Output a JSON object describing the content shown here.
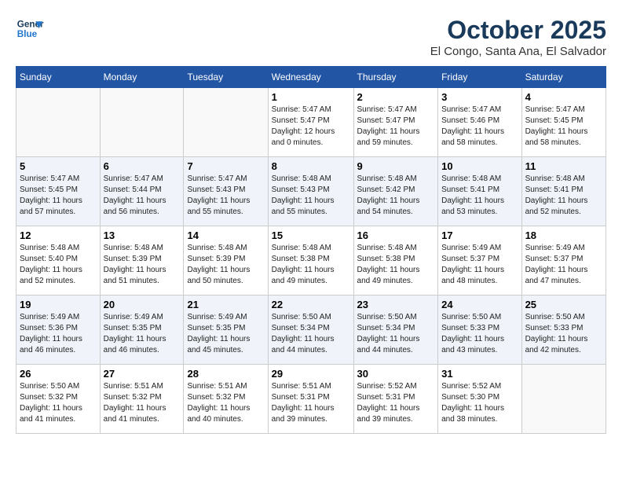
{
  "header": {
    "logo_line1": "General",
    "logo_line2": "Blue",
    "title": "October 2025",
    "subtitle": "El Congo, Santa Ana, El Salvador"
  },
  "weekdays": [
    "Sunday",
    "Monday",
    "Tuesday",
    "Wednesday",
    "Thursday",
    "Friday",
    "Saturday"
  ],
  "weeks": [
    [
      {
        "day": "",
        "info": ""
      },
      {
        "day": "",
        "info": ""
      },
      {
        "day": "",
        "info": ""
      },
      {
        "day": "1",
        "info": "Sunrise: 5:47 AM\nSunset: 5:47 PM\nDaylight: 12 hours\nand 0 minutes."
      },
      {
        "day": "2",
        "info": "Sunrise: 5:47 AM\nSunset: 5:47 PM\nDaylight: 11 hours\nand 59 minutes."
      },
      {
        "day": "3",
        "info": "Sunrise: 5:47 AM\nSunset: 5:46 PM\nDaylight: 11 hours\nand 58 minutes."
      },
      {
        "day": "4",
        "info": "Sunrise: 5:47 AM\nSunset: 5:45 PM\nDaylight: 11 hours\nand 58 minutes."
      }
    ],
    [
      {
        "day": "5",
        "info": "Sunrise: 5:47 AM\nSunset: 5:45 PM\nDaylight: 11 hours\nand 57 minutes."
      },
      {
        "day": "6",
        "info": "Sunrise: 5:47 AM\nSunset: 5:44 PM\nDaylight: 11 hours\nand 56 minutes."
      },
      {
        "day": "7",
        "info": "Sunrise: 5:47 AM\nSunset: 5:43 PM\nDaylight: 11 hours\nand 55 minutes."
      },
      {
        "day": "8",
        "info": "Sunrise: 5:48 AM\nSunset: 5:43 PM\nDaylight: 11 hours\nand 55 minutes."
      },
      {
        "day": "9",
        "info": "Sunrise: 5:48 AM\nSunset: 5:42 PM\nDaylight: 11 hours\nand 54 minutes."
      },
      {
        "day": "10",
        "info": "Sunrise: 5:48 AM\nSunset: 5:41 PM\nDaylight: 11 hours\nand 53 minutes."
      },
      {
        "day": "11",
        "info": "Sunrise: 5:48 AM\nSunset: 5:41 PM\nDaylight: 11 hours\nand 52 minutes."
      }
    ],
    [
      {
        "day": "12",
        "info": "Sunrise: 5:48 AM\nSunset: 5:40 PM\nDaylight: 11 hours\nand 52 minutes."
      },
      {
        "day": "13",
        "info": "Sunrise: 5:48 AM\nSunset: 5:39 PM\nDaylight: 11 hours\nand 51 minutes."
      },
      {
        "day": "14",
        "info": "Sunrise: 5:48 AM\nSunset: 5:39 PM\nDaylight: 11 hours\nand 50 minutes."
      },
      {
        "day": "15",
        "info": "Sunrise: 5:48 AM\nSunset: 5:38 PM\nDaylight: 11 hours\nand 49 minutes."
      },
      {
        "day": "16",
        "info": "Sunrise: 5:48 AM\nSunset: 5:38 PM\nDaylight: 11 hours\nand 49 minutes."
      },
      {
        "day": "17",
        "info": "Sunrise: 5:49 AM\nSunset: 5:37 PM\nDaylight: 11 hours\nand 48 minutes."
      },
      {
        "day": "18",
        "info": "Sunrise: 5:49 AM\nSunset: 5:37 PM\nDaylight: 11 hours\nand 47 minutes."
      }
    ],
    [
      {
        "day": "19",
        "info": "Sunrise: 5:49 AM\nSunset: 5:36 PM\nDaylight: 11 hours\nand 46 minutes."
      },
      {
        "day": "20",
        "info": "Sunrise: 5:49 AM\nSunset: 5:35 PM\nDaylight: 11 hours\nand 46 minutes."
      },
      {
        "day": "21",
        "info": "Sunrise: 5:49 AM\nSunset: 5:35 PM\nDaylight: 11 hours\nand 45 minutes."
      },
      {
        "day": "22",
        "info": "Sunrise: 5:50 AM\nSunset: 5:34 PM\nDaylight: 11 hours\nand 44 minutes."
      },
      {
        "day": "23",
        "info": "Sunrise: 5:50 AM\nSunset: 5:34 PM\nDaylight: 11 hours\nand 44 minutes."
      },
      {
        "day": "24",
        "info": "Sunrise: 5:50 AM\nSunset: 5:33 PM\nDaylight: 11 hours\nand 43 minutes."
      },
      {
        "day": "25",
        "info": "Sunrise: 5:50 AM\nSunset: 5:33 PM\nDaylight: 11 hours\nand 42 minutes."
      }
    ],
    [
      {
        "day": "26",
        "info": "Sunrise: 5:50 AM\nSunset: 5:32 PM\nDaylight: 11 hours\nand 41 minutes."
      },
      {
        "day": "27",
        "info": "Sunrise: 5:51 AM\nSunset: 5:32 PM\nDaylight: 11 hours\nand 41 minutes."
      },
      {
        "day": "28",
        "info": "Sunrise: 5:51 AM\nSunset: 5:32 PM\nDaylight: 11 hours\nand 40 minutes."
      },
      {
        "day": "29",
        "info": "Sunrise: 5:51 AM\nSunset: 5:31 PM\nDaylight: 11 hours\nand 39 minutes."
      },
      {
        "day": "30",
        "info": "Sunrise: 5:52 AM\nSunset: 5:31 PM\nDaylight: 11 hours\nand 39 minutes."
      },
      {
        "day": "31",
        "info": "Sunrise: 5:52 AM\nSunset: 5:30 PM\nDaylight: 11 hours\nand 38 minutes."
      },
      {
        "day": "",
        "info": ""
      }
    ]
  ]
}
